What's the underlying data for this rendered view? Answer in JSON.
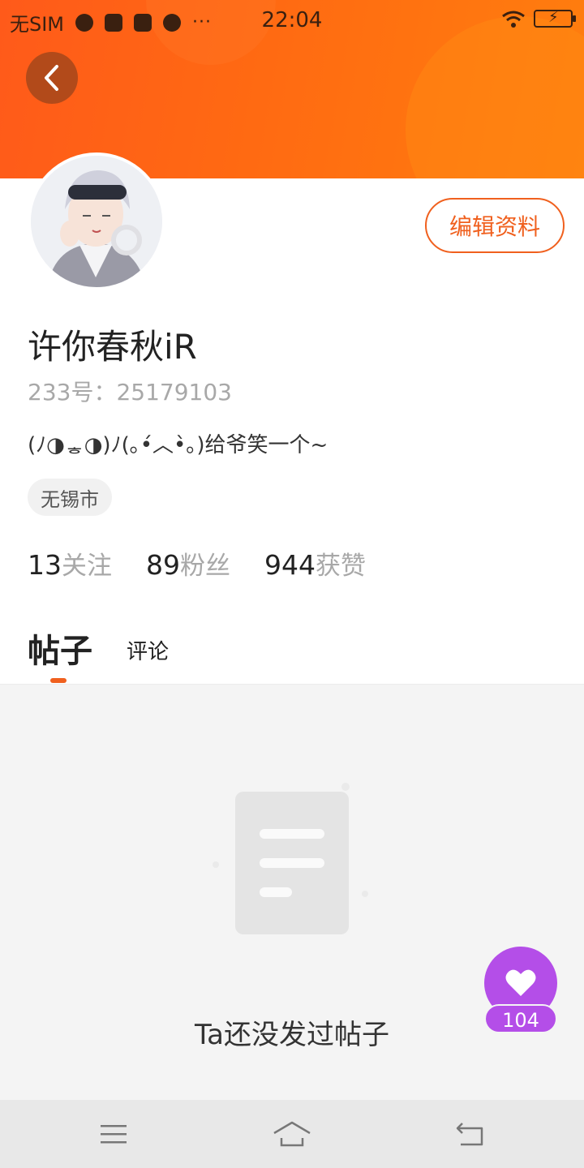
{
  "status_bar": {
    "carrier": "无SIM",
    "time": "22:04",
    "more": "···"
  },
  "profile": {
    "name": "许你春秋iR",
    "id_line": "233号：25179103",
    "bio": "(ﾉ◑ᇂ◑)ﾉ(｡•́︿•̀｡)给爷笑一个~",
    "location": "无锡市",
    "edit_label": "编辑资料"
  },
  "stats": [
    {
      "value": "13",
      "label": "关注"
    },
    {
      "value": "89",
      "label": "粉丝"
    },
    {
      "value": "944",
      "label": "获赞"
    }
  ],
  "tabs": [
    {
      "label": "帖子",
      "active": true
    },
    {
      "label": "评论",
      "active": false
    }
  ],
  "content": {
    "empty_text": "Ta还没发过帖子"
  },
  "like_fab": {
    "count": "104",
    "icon": "heart-icon"
  },
  "nav": {
    "icons": [
      "menu-icon",
      "home-icon",
      "back-nav-icon"
    ]
  },
  "colors": {
    "brand_orange": "#ff6a12",
    "accent": "#f0601e",
    "fab_purple": "#b44ee8"
  }
}
